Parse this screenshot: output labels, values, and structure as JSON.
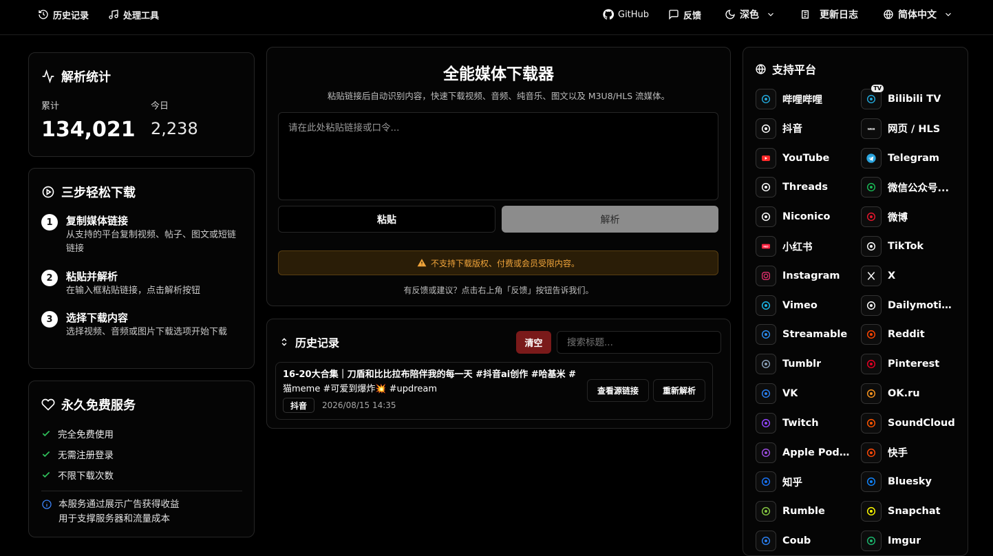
{
  "nav": {
    "history": "历史记录",
    "tools": "处理工具",
    "github": "GitHub",
    "feedback": "反馈",
    "theme": "深色",
    "changelog": "更新日志",
    "language": "简体中文"
  },
  "stats": {
    "title": "解析统计",
    "total_label": "累计",
    "total_value": "134,021",
    "today_label": "今日",
    "today_value": "2,238"
  },
  "steps": {
    "title": "三步轻松下载",
    "items": [
      {
        "num": "1",
        "title": "复制媒体链接",
        "desc": "从支持的平台复制视频、帖子、图文或短链链接"
      },
      {
        "num": "2",
        "title": "粘贴并解析",
        "desc": "在输入框粘贴链接，点击解析按钮"
      },
      {
        "num": "3",
        "title": "选择下载内容",
        "desc": "选择视频、音频或图片下载选项开始下载"
      }
    ]
  },
  "free": {
    "title": "永久免费服务",
    "items": [
      "完全免费使用",
      "无需注册登录",
      "不限下载次数"
    ],
    "note_line1": "本服务通过展示广告获得收益",
    "note_line2": "用于支撑服务器和流量成本"
  },
  "main": {
    "title": "全能媒体下载器",
    "subtitle": "粘贴链接后自动识别内容，快速下载视频、音频、纯音乐、图文以及 M3U8/HLS 流媒体。",
    "input_placeholder": "请在此处粘贴链接或口令...",
    "paste_label": "粘贴",
    "parse_label": "解析",
    "warning": "不支持下载版权、付费或会员受限内容。",
    "feedback_note": "有反馈或建议？点击右上角「反馈」按钮告诉我们。"
  },
  "history": {
    "title": "历史记录",
    "clear_label": "清空",
    "search_placeholder": "搜索标题...",
    "items": [
      {
        "title_line1": "16-20大合集｜刀盾和比比拉布陪伴我的每一天 #抖音ai创作 #哈基米 #",
        "title_line2": "猫meme #可爱到爆炸💥 #updream",
        "platform": "抖音",
        "time": "2026/08/15 14:35",
        "view_source_label": "查看源链接",
        "reparse_label": "重新解析"
      }
    ]
  },
  "platforms": {
    "title": "支持平台",
    "items": [
      {
        "name": "哔哩哔哩",
        "icon": "bilibili-icon",
        "color": "#22a6d8"
      },
      {
        "name": "Bilibili TV",
        "icon": "bilibili-tv-icon",
        "color": "#22a6d8",
        "badge": "TV"
      },
      {
        "name": "抖音",
        "icon": "douyin-icon",
        "color": "#ffffff"
      },
      {
        "name": "网页 / HLS",
        "icon": "web-icon",
        "color": "#ffffff"
      },
      {
        "name": "YouTube",
        "icon": "youtube-icon",
        "color": "#ff2a2a"
      },
      {
        "name": "Telegram",
        "icon": "telegram-icon",
        "color": "#2aa4de"
      },
      {
        "name": "Threads",
        "icon": "threads-icon",
        "color": "#ffffff"
      },
      {
        "name": "微信公众号...",
        "icon": "wechat-icon",
        "color": "#19b955"
      },
      {
        "name": "Niconico",
        "icon": "niconico-icon",
        "color": "#ffffff"
      },
      {
        "name": "微博",
        "icon": "weibo-icon",
        "color": "#e6162d"
      },
      {
        "name": "小红书",
        "icon": "xiaohongshu-icon",
        "color": "#ff2442"
      },
      {
        "name": "TikTok",
        "icon": "tiktok-icon",
        "color": "#ffffff"
      },
      {
        "name": "Instagram",
        "icon": "instagram-icon",
        "color": "#e1306c"
      },
      {
        "name": "X",
        "icon": "x-icon",
        "color": "#ffffff"
      },
      {
        "name": "Vimeo",
        "icon": "vimeo-icon",
        "color": "#1ab7ea"
      },
      {
        "name": "Dailymotion",
        "icon": "dailymotion-icon",
        "color": "#ffffff"
      },
      {
        "name": "Streamable",
        "icon": "streamable-icon",
        "color": "#2a8cf0"
      },
      {
        "name": "Reddit",
        "icon": "reddit-icon",
        "color": "#ff4500"
      },
      {
        "name": "Tumblr",
        "icon": "tumblr-icon",
        "color": "#8aa0b8"
      },
      {
        "name": "Pinterest",
        "icon": "pinterest-icon",
        "color": "#e60023"
      },
      {
        "name": "VK",
        "icon": "vk-icon",
        "color": "#2a7ff0"
      },
      {
        "name": "OK.ru",
        "icon": "okru-icon",
        "color": "#f7931e"
      },
      {
        "name": "Twitch",
        "icon": "twitch-icon",
        "color": "#9146ff"
      },
      {
        "name": "SoundCloud",
        "icon": "soundcloud-icon",
        "color": "#ff5500"
      },
      {
        "name": "Apple Podc...",
        "icon": "apple-podcasts-icon",
        "color": "#9b4de0"
      },
      {
        "name": "快手",
        "icon": "kuaishou-icon",
        "color": "#ff4906"
      },
      {
        "name": "知乎",
        "icon": "zhihu-icon",
        "color": "#1772f6"
      },
      {
        "name": "Bluesky",
        "icon": "bluesky-icon",
        "color": "#1185fe"
      },
      {
        "name": "Rumble",
        "icon": "rumble-icon",
        "color": "#85c742"
      },
      {
        "name": "Snapchat",
        "icon": "snapchat-icon",
        "color": "#fffc00"
      },
      {
        "name": "Coub",
        "icon": "coub-icon",
        "color": "#2a7ff0"
      },
      {
        "name": "Imgur",
        "icon": "imgur-icon",
        "color": "#1bb76e"
      }
    ]
  },
  "colors": {
    "background": "#000000",
    "card_border": "#262626",
    "clear_button": "#7a1a1a",
    "check": "#2fbf5a",
    "warning_text": "#f0a43a",
    "info": "#3b82f6"
  }
}
